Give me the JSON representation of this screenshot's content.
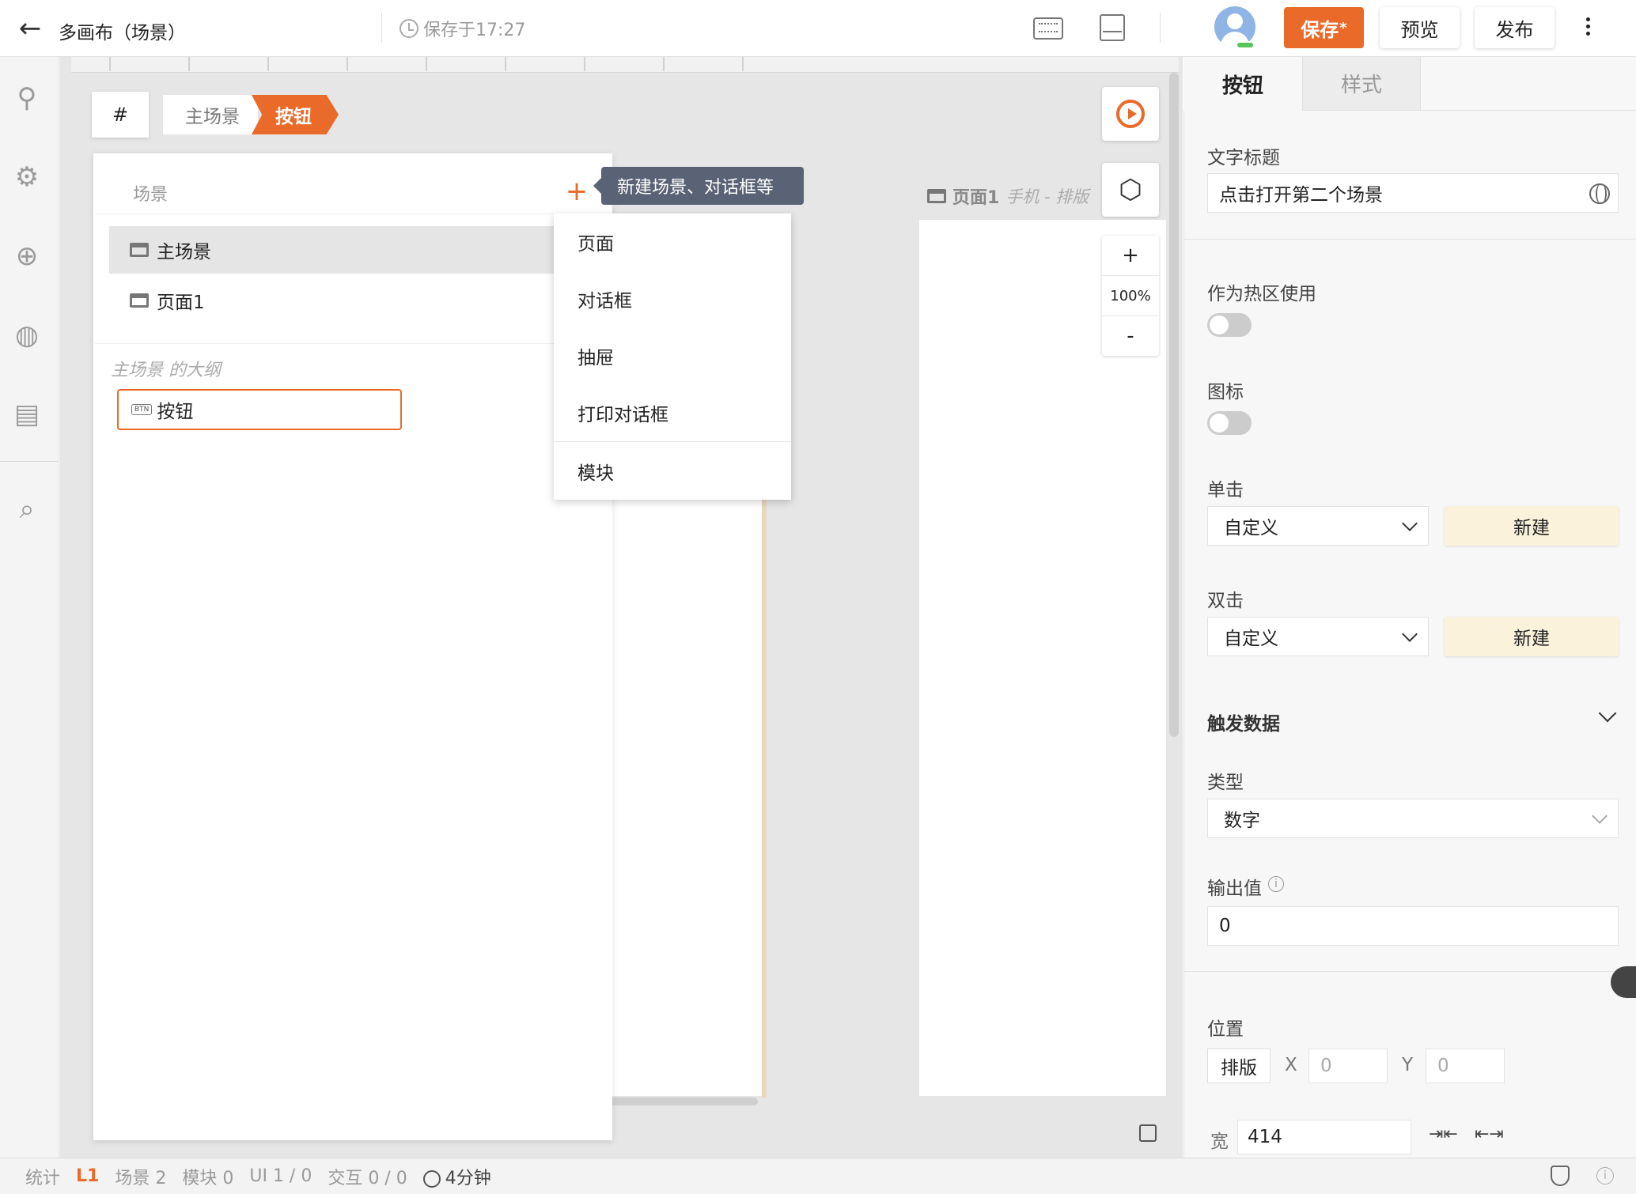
{
  "header": {
    "back_icon": "arrow-left-icon",
    "title": "多画布（场景）",
    "saved_text": "保存于17:27",
    "save_label": "保存",
    "save_marker": "*",
    "preview_label": "预览",
    "publish_label": "发布"
  },
  "left_rail": {
    "items": [
      "plugin-icon",
      "settings-icon",
      "globe-icon",
      "palette-icon",
      "data-icon",
      "search-icon"
    ]
  },
  "canvas": {
    "hash_label": "#",
    "breadcrumb": [
      "主场景",
      "按钮"
    ],
    "page_label": "页面1",
    "page_sublabel": "手机 - 排版",
    "zoom_in": "+",
    "zoom_level": "100%",
    "zoom_out": "-"
  },
  "scene_panel": {
    "heading": "场景",
    "scenes": [
      "主场景",
      "页面1"
    ],
    "outline_label": "主场景 的大纲",
    "outline_item_badge": "BTN",
    "outline_item": "按钮",
    "add_tooltip": "新建场景、对话框等",
    "menu": [
      "页面",
      "对话框",
      "抽屉",
      "打印对话框",
      "模块"
    ]
  },
  "right_panel": {
    "tab_active": "按钮",
    "tab_inactive": "样式",
    "title_label": "文字标题",
    "title_value": "点击打开第二个场景",
    "hotspot_label": "作为热区使用",
    "hotspot_on": false,
    "icon_label": "图标",
    "icon_on": false,
    "click_label": "单击",
    "click_value": "自定义",
    "click_new": "新建",
    "dblclick_label": "双击",
    "dblclick_value": "自定义",
    "dblclick_new": "新建",
    "trigger_section": "触发数据",
    "type_label": "类型",
    "type_value": "数字",
    "output_label": "输出值",
    "output_value": "0",
    "position_label": "位置",
    "layout_btn": "排版",
    "x_label": "X",
    "x_placeholder": "0",
    "y_label": "Y",
    "y_placeholder": "0",
    "width_label": "宽",
    "width_value": "414"
  },
  "status_bar": {
    "stats_label": "统计",
    "level": "L1",
    "scenes": "场景 2",
    "modules": "模块 0",
    "ui": "UI 1 / 0",
    "interactions": "交互 0 / 0",
    "duration": "4分钟"
  },
  "colors": {
    "accent": "#ea6a2a",
    "tooltip_bg": "#5a6275",
    "new_button_bg": "#fbf2dc"
  }
}
